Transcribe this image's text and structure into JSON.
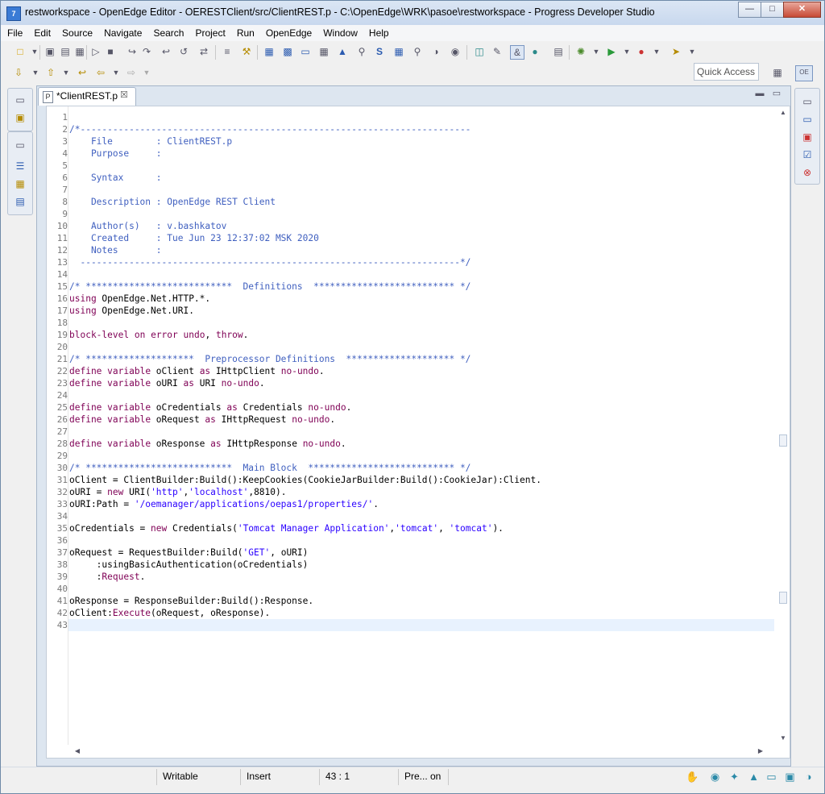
{
  "window": {
    "title": "restworkspace - OpenEdge Editor - OERESTClient/src/ClientREST.p - C:\\OpenEdge\\WRK\\pasoe\\restworkspace - Progress Developer Studio"
  },
  "menu": [
    "File",
    "Edit",
    "Source",
    "Navigate",
    "Search",
    "Project",
    "Run",
    "OpenEdge",
    "Window",
    "Help"
  ],
  "toolbar": {
    "quick_access": "Quick Access"
  },
  "editor": {
    "tab_label": "*ClientREST.p",
    "current_line": 43,
    "lines": [
      {
        "n": "1",
        "text": ""
      },
      {
        "n": "2",
        "text": "/*------------------------------------------------------------------------"
      },
      {
        "n": "3",
        "text": "    File        : ClientREST.p"
      },
      {
        "n": "4",
        "text": "    Purpose     :"
      },
      {
        "n": "5",
        "text": ""
      },
      {
        "n": "6",
        "text": "    Syntax      :"
      },
      {
        "n": "7",
        "text": ""
      },
      {
        "n": "8",
        "text": "    Description : OpenEdge REST Client"
      },
      {
        "n": "9",
        "text": ""
      },
      {
        "n": "10",
        "text": "    Author(s)   : v.bashkatov"
      },
      {
        "n": "11",
        "text": "    Created     : Tue Jun 23 12:37:02 MSK 2020"
      },
      {
        "n": "12",
        "text": "    Notes       :"
      },
      {
        "n": "13",
        "text": "  ----------------------------------------------------------------------*/"
      },
      {
        "n": "14",
        "text": ""
      },
      {
        "n": "15",
        "text": "/* ***************************  Definitions  ************************** */"
      },
      {
        "n": "16",
        "text": "using OpenEdge.Net.HTTP.*."
      },
      {
        "n": "17",
        "text": "using OpenEdge.Net.URI."
      },
      {
        "n": "18",
        "text": ""
      },
      {
        "n": "19",
        "text": "block-level on error undo, throw."
      },
      {
        "n": "20",
        "text": ""
      },
      {
        "n": "21",
        "text": "/* ********************  Preprocessor Definitions  ******************** */"
      },
      {
        "n": "22",
        "text": "define variable oClient as IHttpClient no-undo."
      },
      {
        "n": "23",
        "text": "define variable oURI as URI no-undo."
      },
      {
        "n": "24",
        "text": ""
      },
      {
        "n": "25",
        "text": "define variable oCredentials as Credentials no-undo."
      },
      {
        "n": "26",
        "text": "define variable oRequest as IHttpRequest no-undo."
      },
      {
        "n": "27",
        "text": ""
      },
      {
        "n": "28",
        "text": "define variable oResponse as IHttpResponse no-undo."
      },
      {
        "n": "29",
        "text": ""
      },
      {
        "n": "30",
        "text": "/* ***************************  Main Block  *************************** */"
      },
      {
        "n": "31",
        "text": "oClient = ClientBuilder:Build():KeepCookies(CookieJarBuilder:Build():CookieJar):Client."
      },
      {
        "n": "32",
        "text": "oURI = new URI('http','localhost',8810)."
      },
      {
        "n": "33",
        "text": "oURI:Path = '/oemanager/applications/oepas1/properties/'."
      },
      {
        "n": "34",
        "text": ""
      },
      {
        "n": "35",
        "text": "oCredentials = new Credentials('Tomcat Manager Application','tomcat', 'tomcat')."
      },
      {
        "n": "36",
        "text": ""
      },
      {
        "n": "37",
        "text": "oRequest = RequestBuilder:Build('GET', oURI)"
      },
      {
        "n": "38",
        "text": "     :usingBasicAuthentication(oCredentials)"
      },
      {
        "n": "39",
        "text": "     :Request."
      },
      {
        "n": "40",
        "text": ""
      },
      {
        "n": "41",
        "text": "oResponse = ResponseBuilder:Build():Response."
      },
      {
        "n": "42",
        "text": "oClient:Execute(oRequest, oResponse)."
      },
      {
        "n": "43",
        "text": ""
      }
    ]
  },
  "status": {
    "writable": "Writable",
    "insert": "Insert",
    "position": "43 : 1",
    "preon": "Pre... on"
  },
  "colors": {
    "keyword": "#7f0055",
    "comment": "#3f5fbf",
    "string": "#2a00ff",
    "current_line": "#e8f2fe"
  }
}
